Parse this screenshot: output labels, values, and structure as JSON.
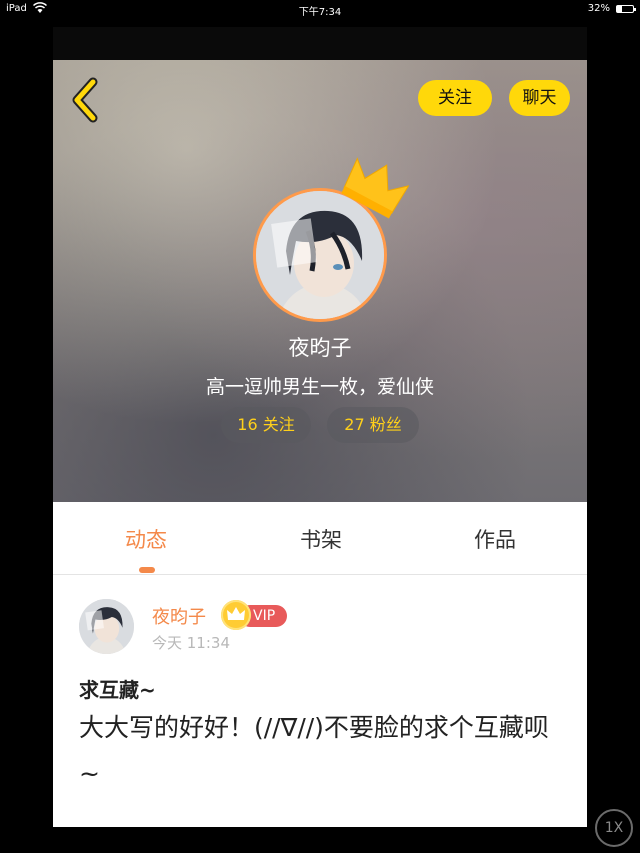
{
  "status_bar": {
    "device": "iPad",
    "time": "下午7:34",
    "battery": "32%",
    "battery_level": 0.32
  },
  "header": {
    "follow_label": "关注",
    "chat_label": "聊天"
  },
  "profile": {
    "name": "夜昀子",
    "bio": "高一逗帅男生一枚，爱仙侠",
    "following": "16 关注",
    "fans": "27 粉丝"
  },
  "tabs": [
    {
      "label": "动态",
      "active": true
    },
    {
      "label": "书架",
      "active": false
    },
    {
      "label": "作品",
      "active": false
    }
  ],
  "post": {
    "author": "夜昀子",
    "vip_label": "VIP",
    "time": "今天 11:34",
    "title": "求互藏~",
    "body": "大大写的好好！(//∇//)不要脸的求个互藏呗~"
  },
  "zoom": "1X",
  "colors": {
    "accent": "#f4894a",
    "button_yellow": "#ffd80a",
    "stat_text": "#ffd01a",
    "vip_red": "#e85a5a"
  }
}
